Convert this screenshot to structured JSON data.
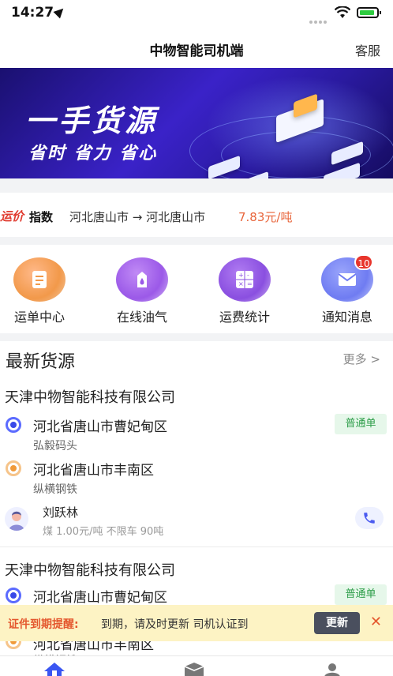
{
  "status_bar": {
    "time": "14:27"
  },
  "nav": {
    "title": "中物智能司机端",
    "service": "客服"
  },
  "banner": {
    "headline": "一手货源",
    "subline": "省时 省力 省心"
  },
  "price_index": {
    "tag": "运价",
    "label": "指数",
    "route": "河北唐山市 → 河北唐山市",
    "value": "7.83元/吨"
  },
  "menu": [
    {
      "label": "运单中心",
      "icon": "waybill-icon",
      "color": "#f2994a"
    },
    {
      "label": "在线油气",
      "icon": "fuel-icon",
      "color": "#9b59e8"
    },
    {
      "label": "运费统计",
      "icon": "calculator-icon",
      "color": "#8a4fe0"
    },
    {
      "label": "通知消息",
      "icon": "mail-icon",
      "color": "#6f7cf2",
      "badge": "10"
    }
  ],
  "cargo": {
    "title": "最新货源",
    "more": "更多 >",
    "items": [
      {
        "company": "天津中物智能科技有限公司",
        "from": "河北省唐山市曹妃甸区",
        "from_sub": "弘毅码头",
        "to": "河北省唐山市丰南区",
        "to_sub": "纵横钢铁",
        "type": "普通单",
        "driver": "刘跃林",
        "meta": "煤 1.00元/吨 不限车 90吨"
      },
      {
        "company": "天津中物智能科技有限公司",
        "from": "河北省唐山市曹妃甸区",
        "to": "河北省唐山市丰南区",
        "to_sub": "纵横钢铁",
        "type": "普通单"
      }
    ]
  },
  "reminder": {
    "label": "证件到期提醒:",
    "text": "到期，请及时更新     司机认证到",
    "button": "更新",
    "close": "✕"
  }
}
